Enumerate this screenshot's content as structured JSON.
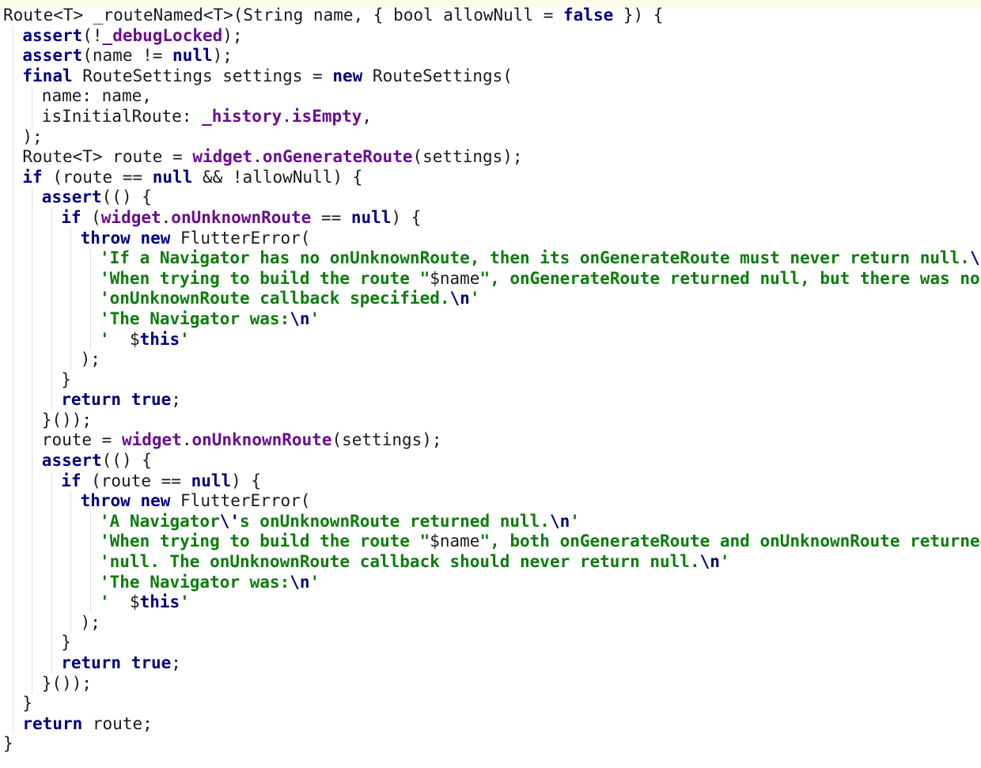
{
  "editor": {
    "background": "#ffffff",
    "colors": {
      "keyword": "#000080",
      "member": "#6a0d91",
      "string": "#0b7d0b",
      "escape": "#000080",
      "plain": "#1a1a1a"
    },
    "lines": [
      {
        "indent": 0,
        "segments": [
          {
            "t": "plain",
            "v": "Route<T> _routeNamed<T>(String name, { bool allowNull = "
          },
          {
            "t": "kw",
            "v": "false"
          },
          {
            "t": "plain",
            "v": " }) {"
          }
        ]
      },
      {
        "indent": 1,
        "segments": [
          {
            "t": "kw",
            "v": "assert"
          },
          {
            "t": "plain",
            "v": "(!"
          },
          {
            "t": "fn",
            "v": "_debugLocked"
          },
          {
            "t": "plain",
            "v": ");"
          }
        ]
      },
      {
        "indent": 1,
        "segments": [
          {
            "t": "kw",
            "v": "assert"
          },
          {
            "t": "plain",
            "v": "(name != "
          },
          {
            "t": "kw",
            "v": "null"
          },
          {
            "t": "plain",
            "v": ");"
          }
        ]
      },
      {
        "indent": 1,
        "segments": [
          {
            "t": "kw",
            "v": "final"
          },
          {
            "t": "plain",
            "v": " RouteSettings settings = "
          },
          {
            "t": "kw",
            "v": "new"
          },
          {
            "t": "plain",
            "v": " RouteSettings("
          }
        ]
      },
      {
        "indent": 2,
        "segments": [
          {
            "t": "plain",
            "v": "name: name,"
          }
        ]
      },
      {
        "indent": 2,
        "segments": [
          {
            "t": "plain",
            "v": "isInitialRoute: "
          },
          {
            "t": "fn",
            "v": "_history"
          },
          {
            "t": "plain",
            "v": "."
          },
          {
            "t": "fn",
            "v": "isEmpty"
          },
          {
            "t": "plain",
            "v": ","
          }
        ]
      },
      {
        "indent": 1,
        "segments": [
          {
            "t": "plain",
            "v": ");"
          }
        ]
      },
      {
        "indent": 1,
        "segments": [
          {
            "t": "plain",
            "v": "Route<T> route = "
          },
          {
            "t": "fn",
            "v": "widget"
          },
          {
            "t": "plain",
            "v": "."
          },
          {
            "t": "fn",
            "v": "onGenerateRoute"
          },
          {
            "t": "plain",
            "v": "(settings);"
          }
        ]
      },
      {
        "indent": 1,
        "segments": [
          {
            "t": "kw",
            "v": "if"
          },
          {
            "t": "plain",
            "v": " (route == "
          },
          {
            "t": "kw",
            "v": "null"
          },
          {
            "t": "plain",
            "v": " && !allowNull) {"
          }
        ]
      },
      {
        "indent": 2,
        "segments": [
          {
            "t": "kw",
            "v": "assert"
          },
          {
            "t": "plain",
            "v": "(() {"
          }
        ]
      },
      {
        "indent": 3,
        "segments": [
          {
            "t": "kw",
            "v": "if"
          },
          {
            "t": "plain",
            "v": " ("
          },
          {
            "t": "fn",
            "v": "widget"
          },
          {
            "t": "plain",
            "v": "."
          },
          {
            "t": "fn",
            "v": "onUnknownRoute"
          },
          {
            "t": "plain",
            "v": " == "
          },
          {
            "t": "kw",
            "v": "null"
          },
          {
            "t": "plain",
            "v": ") {"
          }
        ]
      },
      {
        "indent": 4,
        "segments": [
          {
            "t": "kw",
            "v": "throw new"
          },
          {
            "t": "plain",
            "v": " FlutterError("
          }
        ]
      },
      {
        "indent": 5,
        "segments": [
          {
            "t": "str",
            "v": "'If a Navigator has no onUnknownRoute, then its onGenerateRoute must never return null."
          },
          {
            "t": "esc",
            "v": "\\n"
          },
          {
            "t": "str",
            "v": "'"
          }
        ]
      },
      {
        "indent": 5,
        "segments": [
          {
            "t": "str",
            "v": "'When trying to build the route \""
          },
          {
            "t": "plain",
            "v": "$name"
          },
          {
            "t": "str",
            "v": "\", onGenerateRoute returned null, but there was no '"
          }
        ]
      },
      {
        "indent": 5,
        "segments": [
          {
            "t": "str",
            "v": "'onUnknownRoute callback specified."
          },
          {
            "t": "esc",
            "v": "\\n"
          },
          {
            "t": "str",
            "v": "'"
          }
        ]
      },
      {
        "indent": 5,
        "segments": [
          {
            "t": "str",
            "v": "'The Navigator was:"
          },
          {
            "t": "esc",
            "v": "\\n"
          },
          {
            "t": "str",
            "v": "'"
          }
        ]
      },
      {
        "indent": 5,
        "segments": [
          {
            "t": "str",
            "v": "'  "
          },
          {
            "t": "plain",
            "v": "$"
          },
          {
            "t": "kw",
            "v": "this"
          },
          {
            "t": "str",
            "v": "'"
          }
        ]
      },
      {
        "indent": 4,
        "segments": [
          {
            "t": "plain",
            "v": ");"
          }
        ]
      },
      {
        "indent": 3,
        "segments": [
          {
            "t": "plain",
            "v": "}"
          }
        ]
      },
      {
        "indent": 3,
        "segments": [
          {
            "t": "kw",
            "v": "return true"
          },
          {
            "t": "plain",
            "v": ";"
          }
        ]
      },
      {
        "indent": 2,
        "segments": [
          {
            "t": "plain",
            "v": "}());"
          }
        ]
      },
      {
        "indent": 2,
        "segments": [
          {
            "t": "plain",
            "v": "route = "
          },
          {
            "t": "fn",
            "v": "widget"
          },
          {
            "t": "plain",
            "v": "."
          },
          {
            "t": "fn",
            "v": "onUnknownRoute"
          },
          {
            "t": "plain",
            "v": "(settings);"
          }
        ]
      },
      {
        "indent": 2,
        "segments": [
          {
            "t": "kw",
            "v": "assert"
          },
          {
            "t": "plain",
            "v": "(() {"
          }
        ]
      },
      {
        "indent": 3,
        "segments": [
          {
            "t": "kw",
            "v": "if"
          },
          {
            "t": "plain",
            "v": " (route == "
          },
          {
            "t": "kw",
            "v": "null"
          },
          {
            "t": "plain",
            "v": ") {"
          }
        ]
      },
      {
        "indent": 4,
        "segments": [
          {
            "t": "kw",
            "v": "throw new"
          },
          {
            "t": "plain",
            "v": " FlutterError("
          }
        ]
      },
      {
        "indent": 5,
        "segments": [
          {
            "t": "str",
            "v": "'A Navigator"
          },
          {
            "t": "esc",
            "v": "\\'"
          },
          {
            "t": "str",
            "v": "s onUnknownRoute returned null."
          },
          {
            "t": "esc",
            "v": "\\n"
          },
          {
            "t": "str",
            "v": "'"
          }
        ]
      },
      {
        "indent": 5,
        "segments": [
          {
            "t": "str",
            "v": "'When trying to build the route \""
          },
          {
            "t": "plain",
            "v": "$name"
          },
          {
            "t": "str",
            "v": "\", both onGenerateRoute and onUnknownRoute returned '"
          }
        ]
      },
      {
        "indent": 5,
        "segments": [
          {
            "t": "str",
            "v": "'null. The onUnknownRoute callback should never return null."
          },
          {
            "t": "esc",
            "v": "\\n"
          },
          {
            "t": "str",
            "v": "'"
          }
        ]
      },
      {
        "indent": 5,
        "segments": [
          {
            "t": "str",
            "v": "'The Navigator was:"
          },
          {
            "t": "esc",
            "v": "\\n"
          },
          {
            "t": "str",
            "v": "'"
          }
        ]
      },
      {
        "indent": 5,
        "segments": [
          {
            "t": "str",
            "v": "'  "
          },
          {
            "t": "plain",
            "v": "$"
          },
          {
            "t": "kw",
            "v": "this"
          },
          {
            "t": "str",
            "v": "'"
          }
        ]
      },
      {
        "indent": 4,
        "segments": [
          {
            "t": "plain",
            "v": ");"
          }
        ]
      },
      {
        "indent": 3,
        "segments": [
          {
            "t": "plain",
            "v": "}"
          }
        ]
      },
      {
        "indent": 3,
        "segments": [
          {
            "t": "kw",
            "v": "return true"
          },
          {
            "t": "plain",
            "v": ";"
          }
        ]
      },
      {
        "indent": 2,
        "segments": [
          {
            "t": "plain",
            "v": "}());"
          }
        ]
      },
      {
        "indent": 1,
        "segments": [
          {
            "t": "plain",
            "v": "}"
          }
        ]
      },
      {
        "indent": 1,
        "segments": [
          {
            "t": "kw",
            "v": "return"
          },
          {
            "t": "plain",
            "v": " route;"
          }
        ]
      },
      {
        "indent": 0,
        "segments": [
          {
            "t": "plain",
            "v": "}"
          }
        ]
      }
    ]
  }
}
